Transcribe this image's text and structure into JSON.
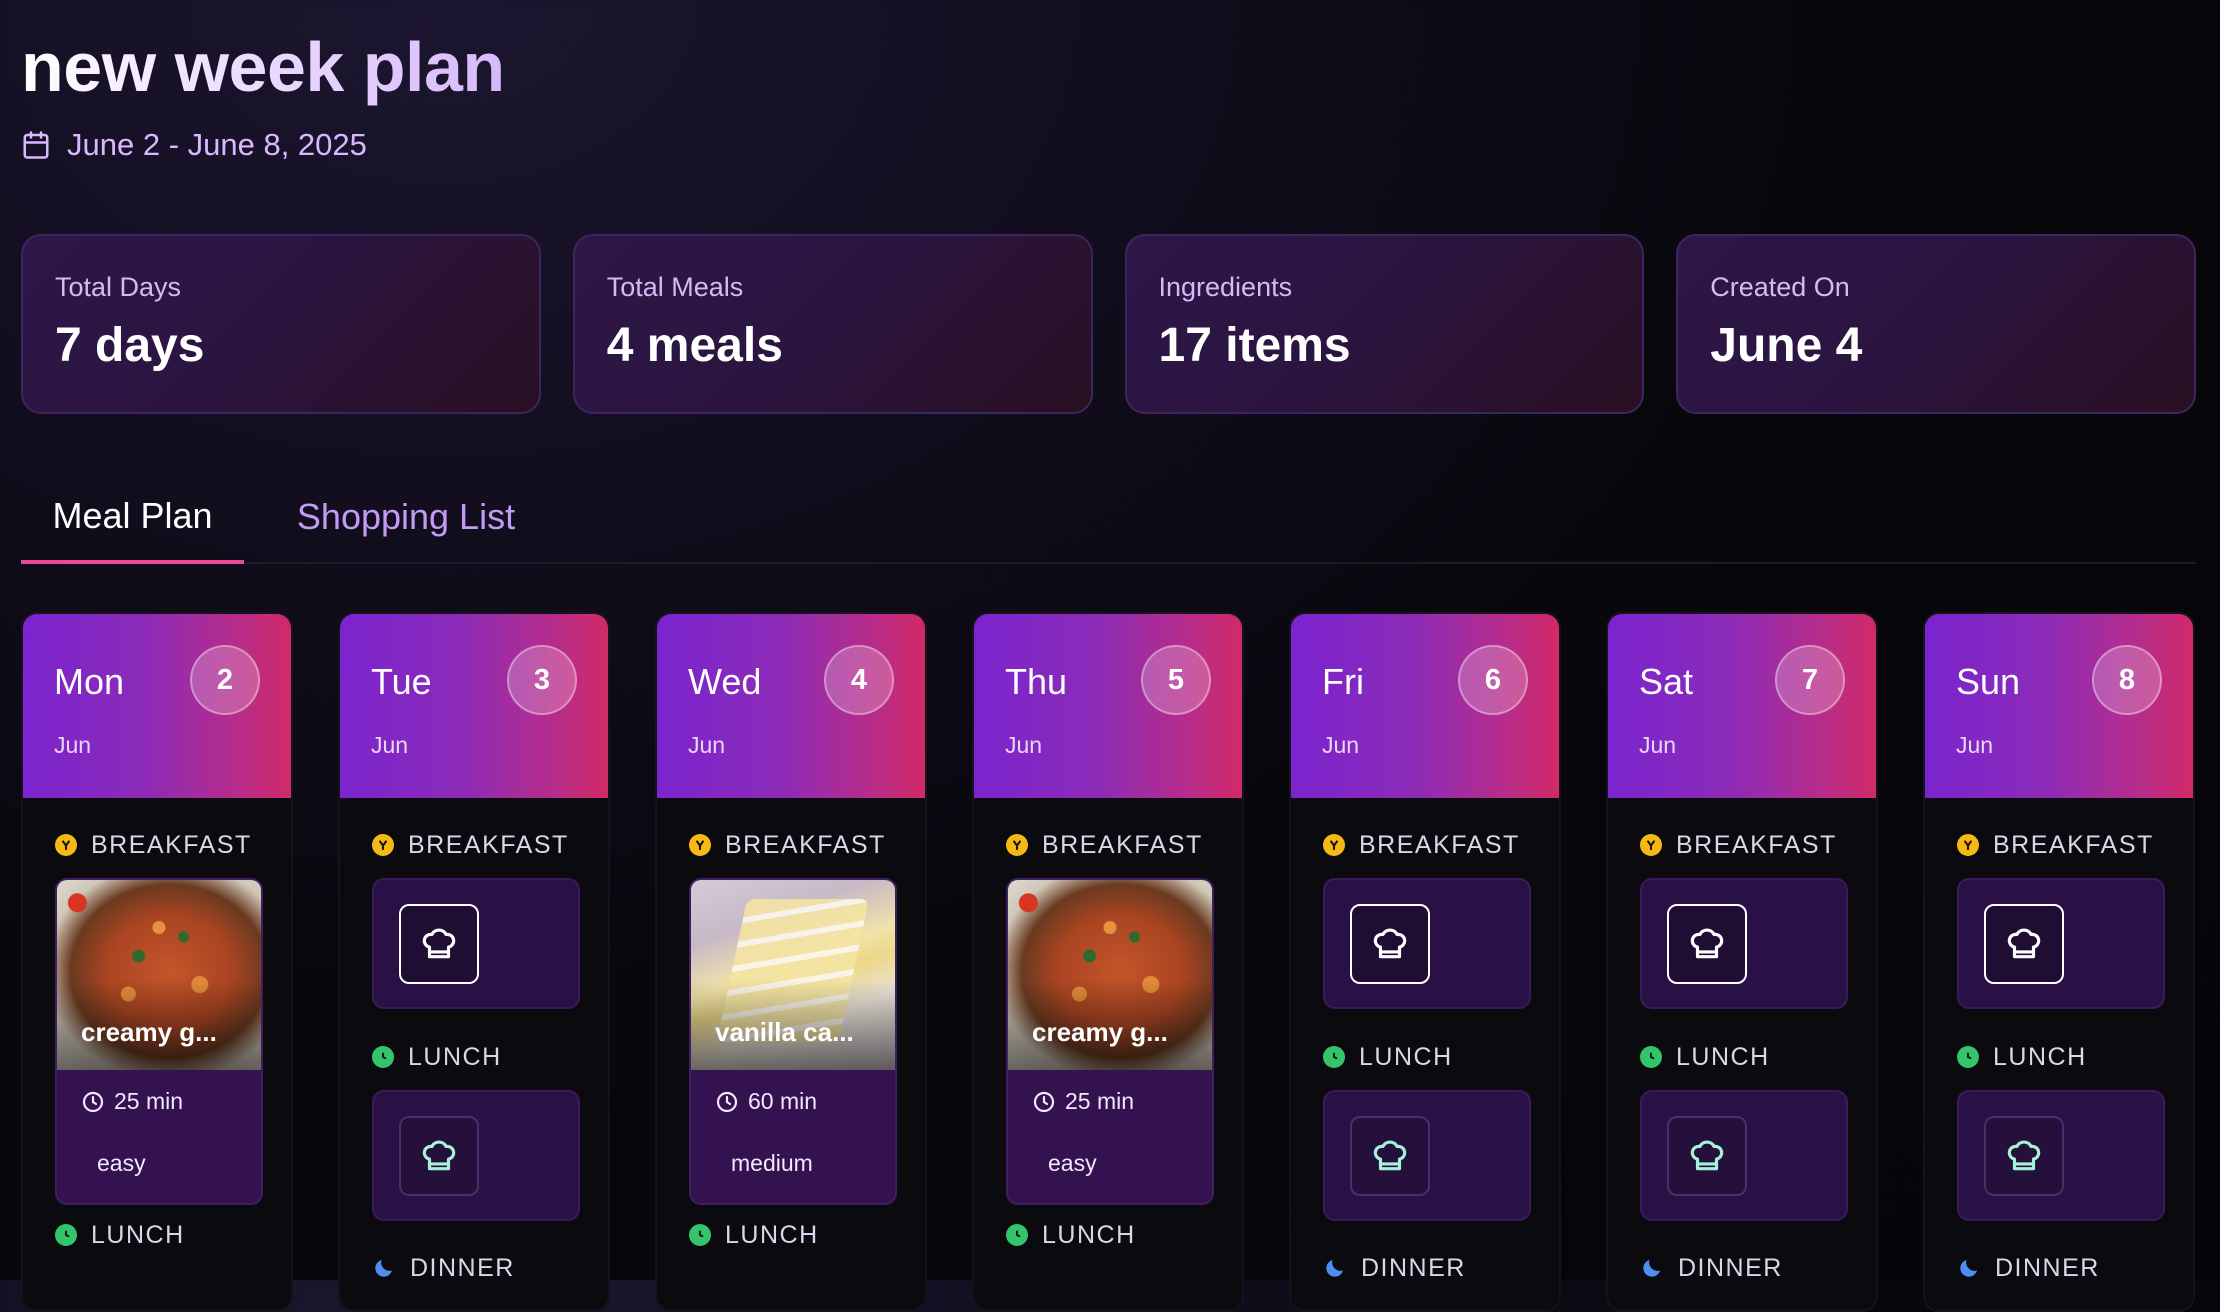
{
  "page": {
    "title": "new week plan",
    "date_range": "June 2 - June 8, 2025"
  },
  "stats": [
    {
      "label": "Total Days",
      "value": "7 days"
    },
    {
      "label": "Total Meals",
      "value": "4 meals"
    },
    {
      "label": "Ingredients",
      "value": "17 items"
    },
    {
      "label": "Created On",
      "value": "June 4"
    }
  ],
  "tabs": [
    {
      "label": "Meal Plan",
      "active": true
    },
    {
      "label": "Shopping List",
      "active": false
    }
  ],
  "meal_labels": {
    "breakfast": "BREAKFAST",
    "lunch": "LUNCH",
    "dinner": "DINNER"
  },
  "colors": {
    "accent": "#ec4899",
    "breakfast_icon": "#f5b915",
    "lunch_icon": "#34c56c",
    "dinner_icon": "#4f8df0"
  },
  "days": [
    {
      "name": "Mon",
      "month": "Jun",
      "date": "2",
      "breakfast": {
        "name": "creamy g...",
        "time": "25 min",
        "difficulty": "easy",
        "image": "pasta"
      }
    },
    {
      "name": "Tue",
      "month": "Jun",
      "date": "3"
    },
    {
      "name": "Wed",
      "month": "Jun",
      "date": "4",
      "breakfast": {
        "name": "vanilla ca...",
        "time": "60 min",
        "difficulty": "medium",
        "image": "cake"
      }
    },
    {
      "name": "Thu",
      "month": "Jun",
      "date": "5",
      "breakfast": {
        "name": "creamy g...",
        "time": "25 min",
        "difficulty": "easy",
        "image": "pasta"
      }
    },
    {
      "name": "Fri",
      "month": "Jun",
      "date": "6"
    },
    {
      "name": "Sat",
      "month": "Jun",
      "date": "7"
    },
    {
      "name": "Sun",
      "month": "Jun",
      "date": "8"
    }
  ]
}
